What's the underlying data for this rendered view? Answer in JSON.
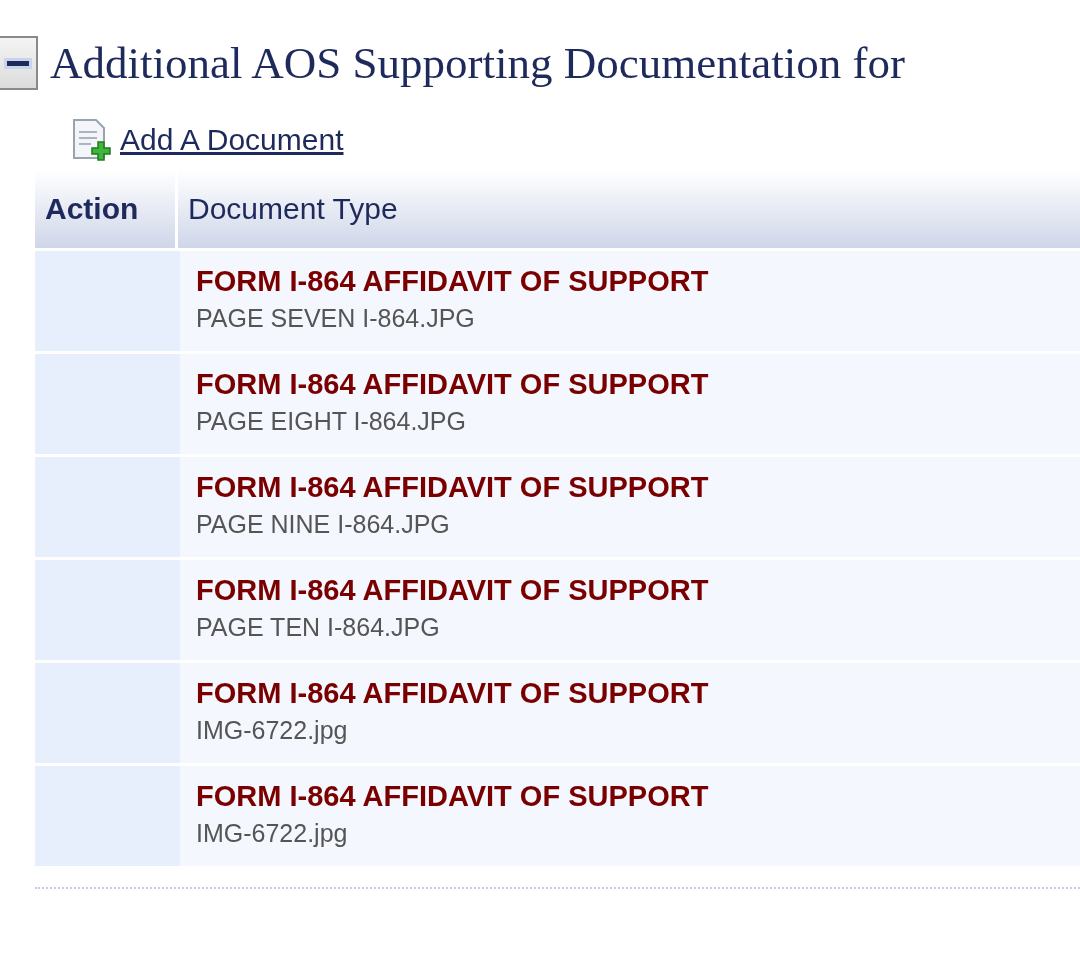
{
  "section": {
    "title": "Additional AOS Supporting Documentation for",
    "expanded": true
  },
  "add_link": "Add A Document",
  "table": {
    "columns": [
      "Action",
      "Document Type"
    ],
    "rows": [
      {
        "document_type": "FORM I-864 AFFIDAVIT OF SUPPORT",
        "file_name": "PAGE SEVEN I-864.JPG"
      },
      {
        "document_type": "FORM I-864 AFFIDAVIT OF SUPPORT",
        "file_name": "PAGE EIGHT I-864.JPG"
      },
      {
        "document_type": "FORM I-864 AFFIDAVIT OF SUPPORT",
        "file_name": "PAGE NINE I-864.JPG"
      },
      {
        "document_type": "FORM I-864 AFFIDAVIT OF SUPPORT",
        "file_name": "PAGE TEN I-864.JPG"
      },
      {
        "document_type": "FORM I-864 AFFIDAVIT OF SUPPORT",
        "file_name": "IMG-6722.jpg"
      },
      {
        "document_type": "FORM I-864 AFFIDAVIT OF SUPPORT",
        "file_name": "IMG-6722.jpg"
      }
    ]
  }
}
